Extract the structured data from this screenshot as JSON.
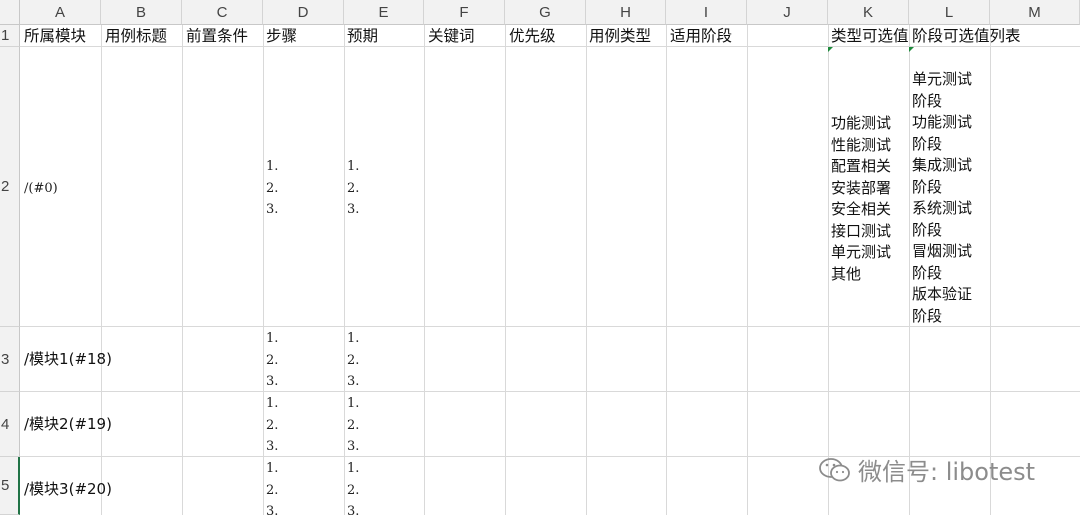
{
  "column_letters": [
    "A",
    "B",
    "C",
    "D",
    "E",
    "F",
    "G",
    "H",
    "I",
    "J",
    "K",
    "L",
    "M"
  ],
  "row_numbers": [
    "1",
    "2",
    "3",
    "4",
    "5"
  ],
  "header_row": {
    "A": "所属模块",
    "B": "用例标题",
    "C": "前置条件",
    "D": "步骤",
    "E": "预期",
    "F": "关键词",
    "G": "优先级",
    "H": "用例类型",
    "I": "适用阶段",
    "K": "类型可选值",
    "L": "阶段可选值列表"
  },
  "rows": [
    {
      "module": "/(#0)",
      "steps": [
        "1.",
        "2.",
        "3."
      ],
      "expected": [
        "1.",
        "2.",
        "3."
      ]
    },
    {
      "module": "/模块1(#18)",
      "steps": [
        "1.",
        "2.",
        "3."
      ],
      "expected": [
        "1.",
        "2.",
        "3."
      ]
    },
    {
      "module": "/模块2(#19)",
      "steps": [
        "1.",
        "2.",
        "3."
      ],
      "expected": [
        "1.",
        "2.",
        "3."
      ]
    },
    {
      "module": "/模块3(#20)",
      "steps": [
        "1.",
        "2.",
        "3."
      ],
      "expected": [
        "1.",
        "2.",
        "3."
      ]
    }
  ],
  "type_options": [
    "功能测试",
    "性能测试",
    "配置相关",
    "安装部署",
    "安全相关",
    "接口测试",
    "单元测试",
    "其他"
  ],
  "stage_options_wrapped": [
    "单元测试",
    "阶段",
    "功能测试",
    "阶段",
    "集成测试",
    "阶段",
    "系统测试",
    "阶段",
    "冒烟测试",
    "阶段",
    "版本验证",
    "阶段"
  ],
  "watermark": {
    "text": "微信号: libotest",
    "icon": "wechat-icon"
  },
  "colors": {
    "grid": "#d9d9d9",
    "header_bg": "#f2f2f2",
    "accent": "#217346",
    "comment_marker": "#1e8a3c"
  }
}
